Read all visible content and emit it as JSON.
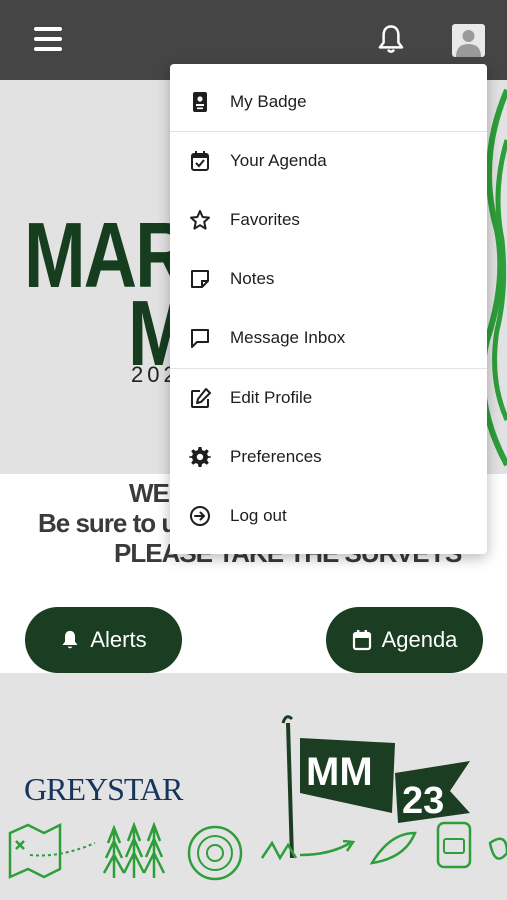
{
  "menu": {
    "items": [
      {
        "label": "My Badge",
        "icon": "badge-icon"
      },
      {
        "label": "Your Agenda",
        "icon": "calendar-check-icon"
      },
      {
        "label": "Favorites",
        "icon": "star-icon"
      },
      {
        "label": "Notes",
        "icon": "note-icon"
      },
      {
        "label": "Message Inbox",
        "icon": "message-icon"
      },
      {
        "label": "Edit Profile",
        "icon": "edit-icon"
      },
      {
        "label": "Preferences",
        "icon": "gear-icon"
      },
      {
        "label": "Log out",
        "icon": "logout-icon"
      }
    ]
  },
  "hero": {
    "line1": "MAR",
    "line2": "M",
    "year": "202"
  },
  "welcome": {
    "line1": "WEL",
    "line2": "Be sure to us",
    "line3": "PLEASE TAKE THE SURVEYS"
  },
  "buttons": {
    "alerts": "Alerts",
    "agenda": "Agenda"
  },
  "footer": {
    "sponsor": "GREYSTAR",
    "flag_text": "MM",
    "flag_number": "23"
  },
  "colors": {
    "topbar": "#454545",
    "brand_green": "#1b3d22",
    "bright_green": "#2e9e3a"
  }
}
